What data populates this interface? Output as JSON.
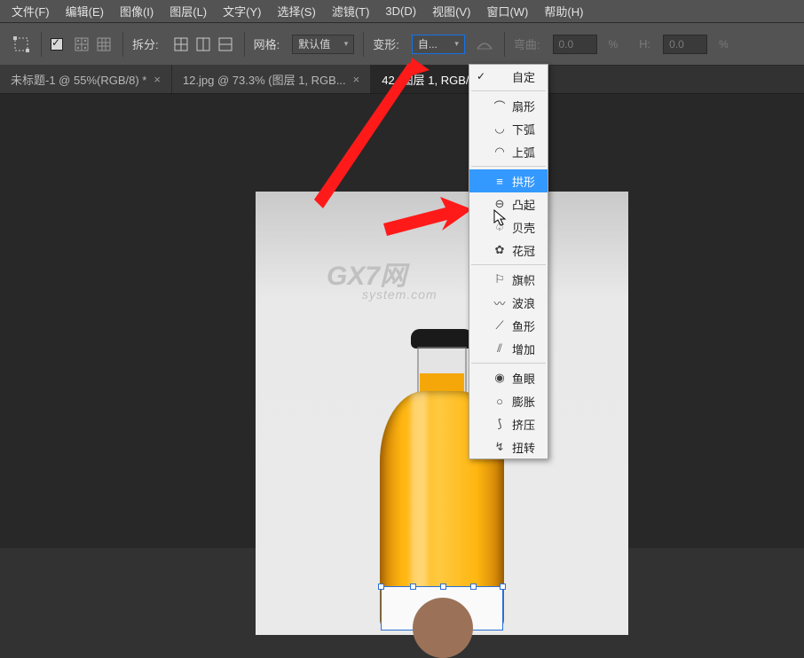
{
  "menubar": [
    "文件(F)",
    "编辑(E)",
    "图像(I)",
    "图层(L)",
    "文字(Y)",
    "选择(S)",
    "滤镜(T)",
    "3D(D)",
    "视图(V)",
    "窗口(W)",
    "帮助(H)"
  ],
  "toolbar": {
    "split_label": "拆分:",
    "grid_label": "网格:",
    "grid_value": "默认值",
    "warp_label": "变形:",
    "warp_value": "自...",
    "bend_label": "弯曲:",
    "bend_value": "0.0",
    "h_label": "H:",
    "h_value": "0.0"
  },
  "tabs": [
    {
      "label": "未标题-1 @ 55%(RGB/8) *"
    },
    {
      "label": "12.jpg @ 73.3% (图层 1, RGB..."
    },
    {
      "label": "42                      (图层 1, RGB/8#) *"
    }
  ],
  "watermark": {
    "main": "GX7网",
    "sub": "system.com"
  },
  "warp_menu": {
    "items": [
      {
        "label": "自定",
        "check": true,
        "icon": ""
      },
      {
        "type": "div"
      },
      {
        "label": "扇形",
        "icon": "⌒"
      },
      {
        "label": "下弧",
        "icon": "◡"
      },
      {
        "label": "上弧",
        "icon": "◠"
      },
      {
        "type": "div"
      },
      {
        "label": "拱形",
        "icon": "≡",
        "selected": true
      },
      {
        "label": "凸起",
        "icon": "⊖"
      },
      {
        "label": "贝壳",
        "icon": "♤"
      },
      {
        "label": "花冠",
        "icon": "✿"
      },
      {
        "type": "div"
      },
      {
        "label": "旗帜",
        "icon": "⚐"
      },
      {
        "label": "波浪",
        "icon": "〰"
      },
      {
        "label": "鱼形",
        "icon": "⟋"
      },
      {
        "label": "增加",
        "icon": "⫽"
      },
      {
        "type": "div"
      },
      {
        "label": "鱼眼",
        "icon": "◉"
      },
      {
        "label": "膨胀",
        "icon": "○"
      },
      {
        "label": "挤压",
        "icon": "⟆"
      },
      {
        "label": "扭转",
        "icon": "↯"
      }
    ]
  }
}
